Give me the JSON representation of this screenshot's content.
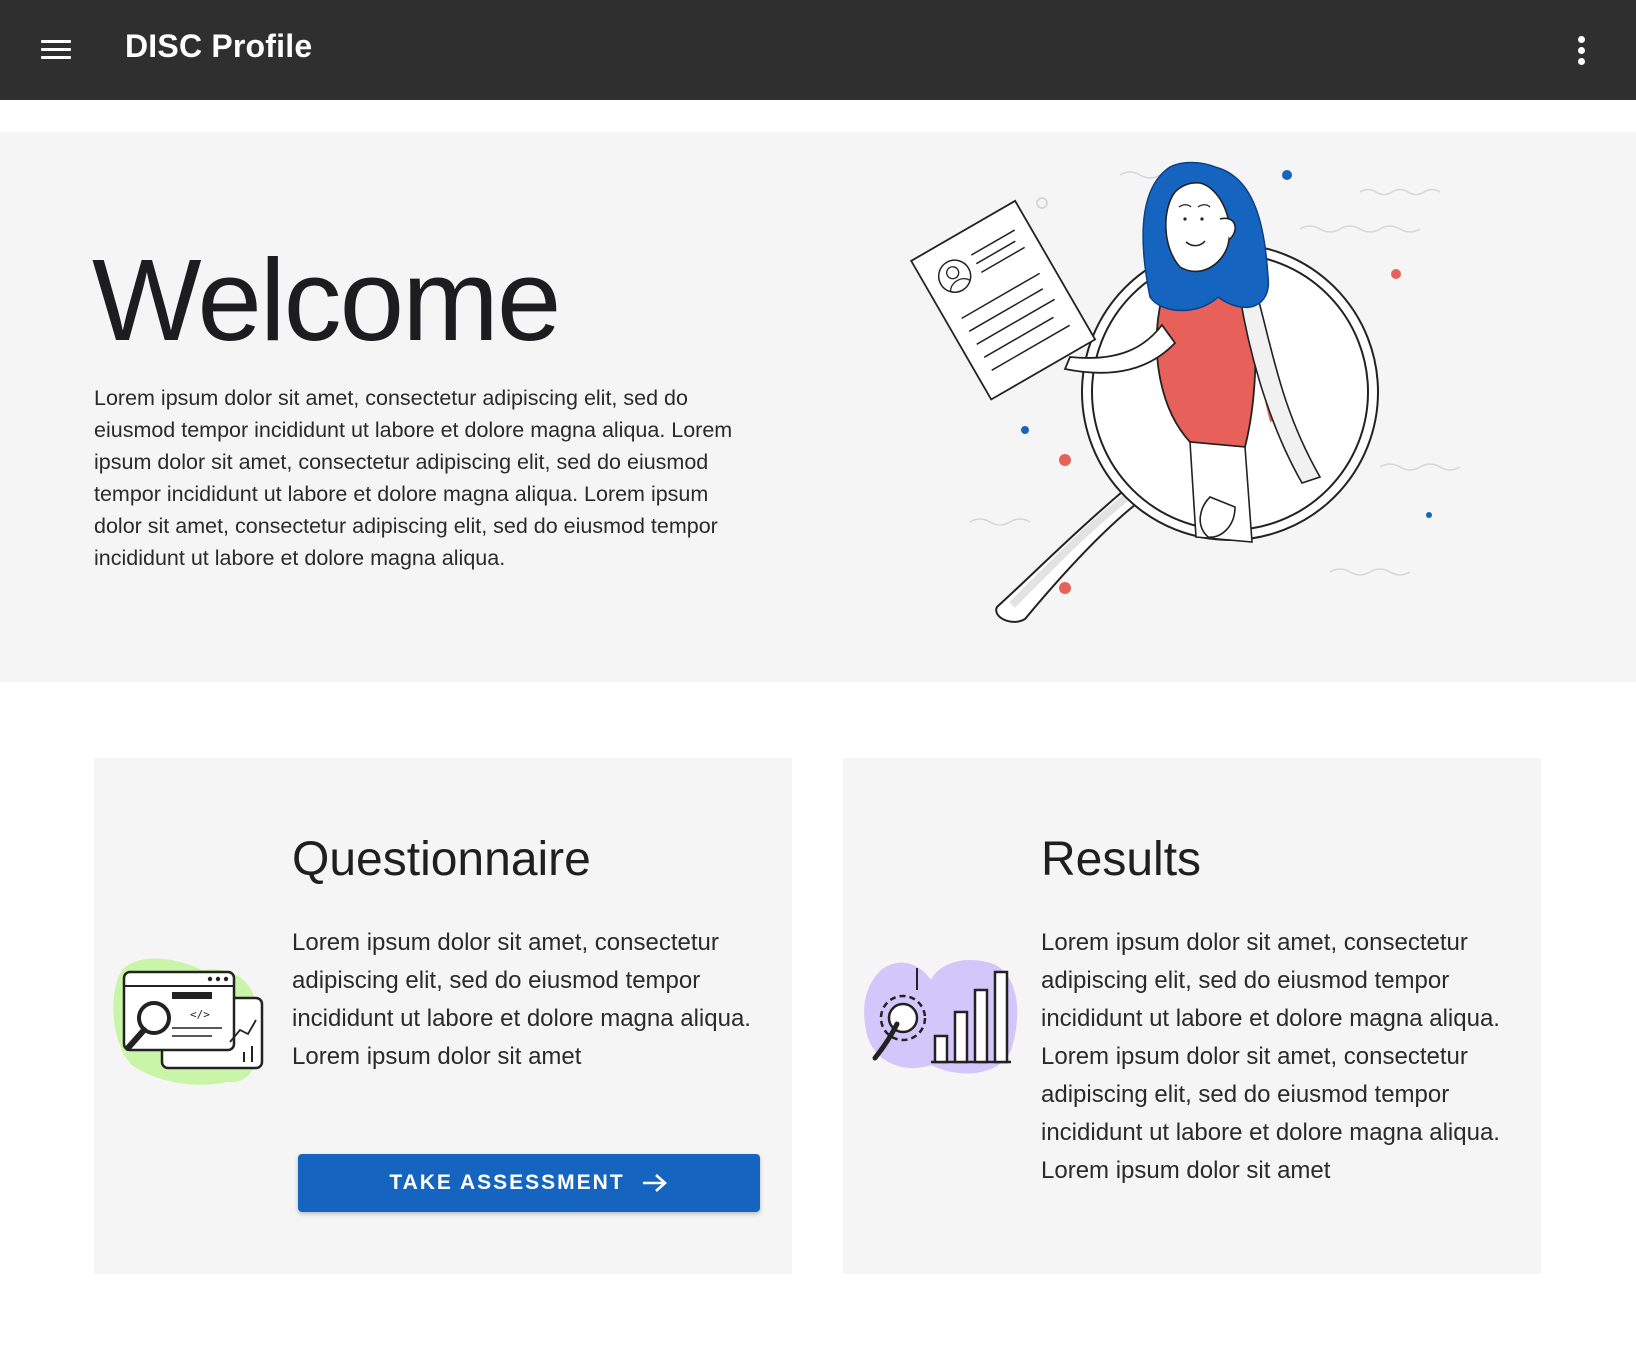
{
  "appbar": {
    "title": "DISC Profile",
    "menu_icon": "hamburger-menu-icon",
    "more_icon": "more-vertical-icon",
    "background": "#2f2f2f"
  },
  "hero": {
    "title": "Welcome",
    "body": "Lorem ipsum dolor sit amet, consectetur adipiscing elit, sed do eiusmod tempor incididunt ut labore et dolore magna aliqua. Lorem ipsum dolor sit amet, consectetur adipiscing elit, sed do eiusmod tempor incididunt ut labore et dolore magna aliqua. Lorem ipsum dolor sit amet, consectetur adipiscing elit, sed do eiusmod tempor incididunt ut labore et dolore magna aliqua.",
    "illustration": "woman-holding-resume-illustration"
  },
  "cards": {
    "questionnaire": {
      "title": "Questionnaire",
      "body": "Lorem ipsum dolor sit amet, consectetur adipiscing elit, sed do eiusmod tempor incididunt ut labore et dolore magna aliqua. Lorem ipsum dolor sit amet",
      "icon": "browser-search-icon",
      "button_label": "TAKE ASSESSMENT",
      "button_icon": "arrow-right-icon"
    },
    "results": {
      "title": "Results",
      "body": "Lorem ipsum dolor sit amet, consectetur adipiscing elit, sed do eiusmod tempor incididunt ut labore et dolore magna aliqua. Lorem ipsum dolor sit amet, consectetur adipiscing elit, sed do eiusmod tempor incididunt ut labore et dolore magna aliqua. Lorem ipsum dolor sit amet",
      "icon": "bar-chart-gear-icon"
    }
  },
  "colors": {
    "accent": "#1565c0",
    "hair": "#1565c0",
    "shirt": "#e8605a",
    "blob_green": "#c8f5a8",
    "blob_purple": "#d3c6fb"
  }
}
